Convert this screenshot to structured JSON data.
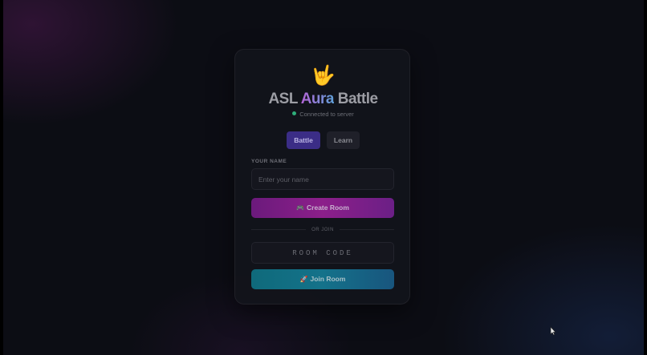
{
  "app": {
    "logo_emoji": "🤟",
    "title_part1": "ASL",
    "title_part2": "Aura",
    "title_part3": "Battle",
    "status_text": "Connected to server"
  },
  "tabs": [
    {
      "label": "Battle",
      "active": true
    },
    {
      "label": "Learn",
      "active": false
    }
  ],
  "form": {
    "name_label": "YOUR NAME",
    "name_placeholder": "Enter your name",
    "name_value": "",
    "create_icon": "🎮",
    "create_label": "Create Room",
    "divider_text": "OR JOIN",
    "code_placeholder": "ROOM CODE",
    "code_value": "",
    "join_icon": "🚀",
    "join_label": "Join Room"
  },
  "colors": {
    "accent_purple": "#3b2d86",
    "create_button": "#8c1f8a",
    "join_button": "#14728a",
    "status_connected": "#2fae7a"
  },
  "icons": {
    "logo": "ily-hand-sign-icon",
    "status": "status-dot-icon",
    "create": "game-controller-icon",
    "join": "rocket-icon",
    "cursor": "mouse-pointer-icon"
  }
}
